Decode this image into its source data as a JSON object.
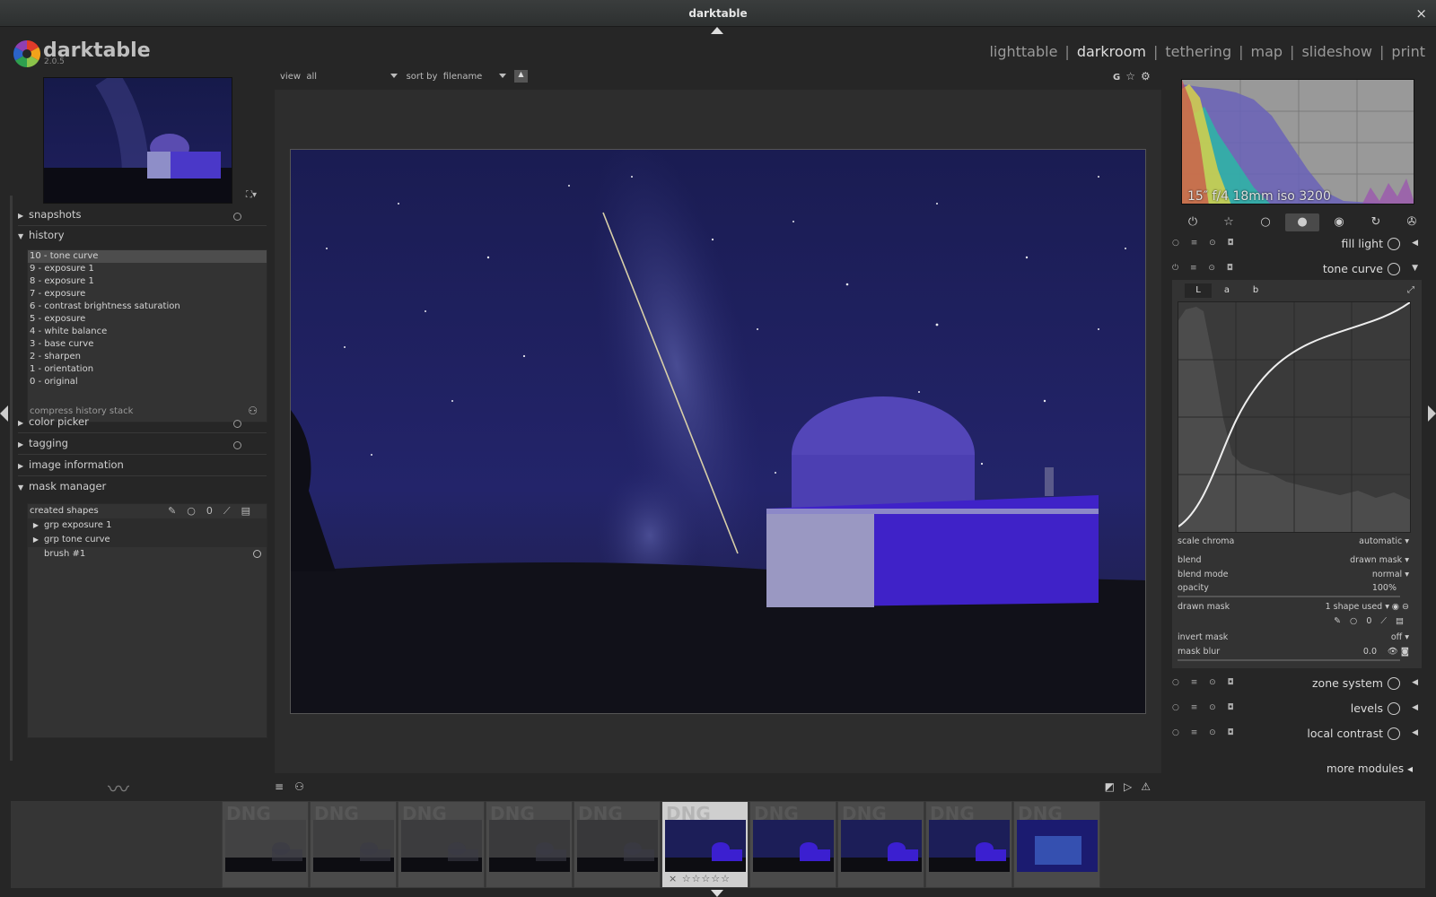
{
  "window": {
    "title": "darktable",
    "close_glyph": "×"
  },
  "app": {
    "name": "darktable",
    "version": "2.0.5"
  },
  "views": [
    {
      "label": "lighttable",
      "active": false
    },
    {
      "label": "darkroom",
      "active": true
    },
    {
      "label": "tethering",
      "active": false
    },
    {
      "label": "map",
      "active": false
    },
    {
      "label": "slideshow",
      "active": false
    },
    {
      "label": "print",
      "active": false
    }
  ],
  "views_separator": "|",
  "filter": {
    "view_label": "view",
    "view_value": "all",
    "sort_label": "sort by",
    "sort_value": "filename",
    "sort_dir_glyph": "▲"
  },
  "top_right_icons": {
    "g_label": "G",
    "star": "☆",
    "gear": "⚙"
  },
  "left": {
    "sections": {
      "snapshots": "snapshots",
      "history": "history",
      "color_picker": "color picker",
      "tagging": "tagging",
      "image_information": "image information",
      "mask_manager": "mask manager"
    },
    "history_items": [
      "10 - tone curve",
      "9 - exposure 1",
      "8 - exposure 1",
      "7 - exposure",
      "6 - contrast brightness saturation",
      "5 - exposure",
      "4 - white balance",
      "3 - base curve",
      "2 - sharpen",
      "1 - orientation",
      "0 - original"
    ],
    "history_selected_index": 0,
    "compress_label": "compress history stack",
    "mask": {
      "header": "created shapes",
      "rows": [
        {
          "label": "grp exposure 1",
          "type": "group"
        },
        {
          "label": "grp tone curve",
          "type": "group"
        },
        {
          "label": "brush #1",
          "type": "shape"
        }
      ]
    }
  },
  "right": {
    "exif": "15″ f/4 18mm iso 3200",
    "modules": {
      "fill_light": "fill light",
      "tone_curve": "tone curve",
      "zone_system": "zone system",
      "levels": "levels",
      "local_contrast": "local contrast"
    },
    "tabs": [
      "L",
      "a",
      "b"
    ],
    "active_tab": "L",
    "params": {
      "scale_chroma": {
        "label": "scale chroma",
        "value": "automatic"
      },
      "blend": {
        "label": "blend",
        "value": "drawn mask"
      },
      "blend_mode": {
        "label": "blend mode",
        "value": "normal"
      },
      "opacity": {
        "label": "opacity",
        "value": "100%"
      },
      "drawn_mask": {
        "label": "drawn mask",
        "value": "1 shape used"
      },
      "invert_mask": {
        "label": "invert mask",
        "value": "off"
      },
      "mask_blur": {
        "label": "mask blur",
        "value": "0.0"
      }
    },
    "more_modules": "more modules"
  },
  "filmstrip": {
    "thumb_label": "DNG",
    "count": 10,
    "current_index": 5,
    "stars": "☆☆☆☆☆",
    "reject": "×"
  }
}
